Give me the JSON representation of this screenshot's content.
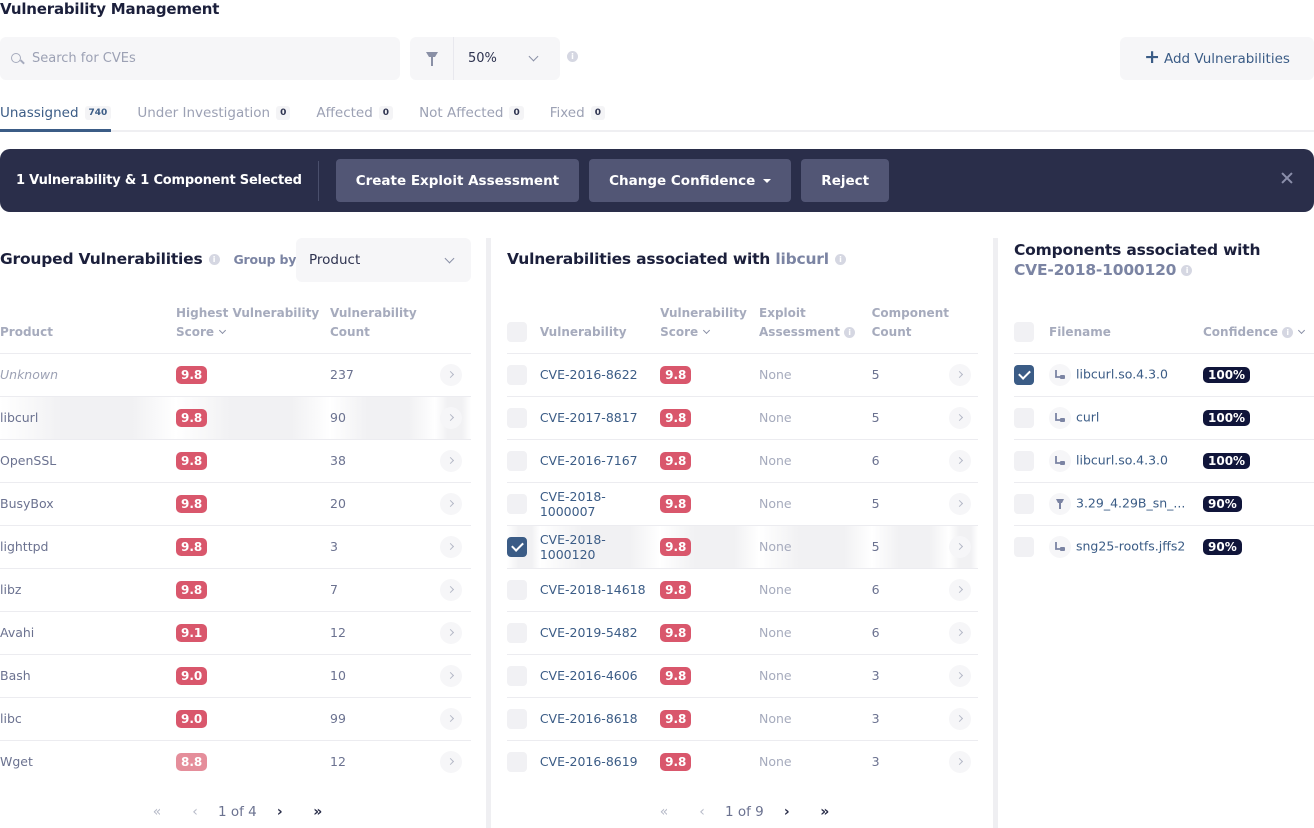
{
  "header": {
    "title": "Vulnerability Management",
    "search_placeholder": "Search for CVEs",
    "search_value": "",
    "confidence_value": "50%",
    "add_button_label": "Add Vulnerabilities",
    "add_button_icon": "plus-icon"
  },
  "tabs": [
    {
      "label": "Unassigned",
      "count": "740",
      "active": true
    },
    {
      "label": "Under Investigation",
      "count": "0",
      "active": false
    },
    {
      "label": "Affected",
      "count": "0",
      "active": false
    },
    {
      "label": "Not Affected",
      "count": "0",
      "active": false
    },
    {
      "label": "Fixed",
      "count": "0",
      "active": false
    }
  ],
  "selection_bar": {
    "text": "1 Vulnerability & 1 Component Selected",
    "buttons": {
      "create_exploit": "Create Exploit Assessment",
      "change_confidence": "Change Confidence",
      "reject": "Reject"
    },
    "colors": {
      "background": "#2a2e4a",
      "button": "#525675"
    }
  },
  "grouped": {
    "title": "Grouped Vulnerabilities",
    "group_by_label": "Group by",
    "group_by_value": "Product",
    "columns": {
      "product": "Product",
      "score": "Highest Vulnerability Score",
      "count": "Vulnerability Count"
    },
    "rows": [
      {
        "product": "Unknown",
        "score": "9.8",
        "count": "237",
        "italic": true
      },
      {
        "product": "libcurl",
        "score": "9.8",
        "count": "90",
        "highlighted": true
      },
      {
        "product": "OpenSSL",
        "score": "9.8",
        "count": "38"
      },
      {
        "product": "BusyBox",
        "score": "9.8",
        "count": "20"
      },
      {
        "product": "lighttpd",
        "score": "9.8",
        "count": "3"
      },
      {
        "product": "libz",
        "score": "9.8",
        "count": "7"
      },
      {
        "product": "Avahi",
        "score": "9.1",
        "count": "12"
      },
      {
        "product": "Bash",
        "score": "9.0",
        "count": "10"
      },
      {
        "product": "libc",
        "score": "9.0",
        "count": "99"
      },
      {
        "product": "Wget",
        "score": "8.8",
        "count": "12",
        "light": true
      }
    ],
    "pagination": {
      "text": "1 of 4"
    }
  },
  "vulns": {
    "title_prefix": "Vulnerabilities associated with",
    "title_subject": "libcurl",
    "columns": {
      "vulnerability": "Vulnerability",
      "score": "Vulnerability Score",
      "exploit": "Exploit Assessment",
      "component_count": "Component Count"
    },
    "rows": [
      {
        "cve": "CVE-2016-8622",
        "score": "9.8",
        "exploit": "None",
        "count": "5",
        "checked": false
      },
      {
        "cve": "CVE-2017-8817",
        "score": "9.8",
        "exploit": "None",
        "count": "5",
        "checked": false
      },
      {
        "cve": "CVE-2016-7167",
        "score": "9.8",
        "exploit": "None",
        "count": "6",
        "checked": false
      },
      {
        "cve": "CVE-2018-1000007",
        "score": "9.8",
        "exploit": "None",
        "count": "5",
        "checked": false
      },
      {
        "cve": "CVE-2018-1000120",
        "score": "9.8",
        "exploit": "None",
        "count": "5",
        "checked": true
      },
      {
        "cve": "CVE-2018-14618",
        "score": "9.8",
        "exploit": "None",
        "count": "6",
        "checked": false
      },
      {
        "cve": "CVE-2019-5482",
        "score": "9.8",
        "exploit": "None",
        "count": "6",
        "checked": false
      },
      {
        "cve": "CVE-2016-4606",
        "score": "9.8",
        "exploit": "None",
        "count": "3",
        "checked": false
      },
      {
        "cve": "CVE-2016-8618",
        "score": "9.8",
        "exploit": "None",
        "count": "3",
        "checked": false
      },
      {
        "cve": "CVE-2016-8619",
        "score": "9.8",
        "exploit": "None",
        "count": "3",
        "checked": false
      }
    ],
    "pagination": {
      "text": "1 of 9"
    }
  },
  "components": {
    "title_prefix": "Components associated with",
    "title_subject": "CVE-2018-1000120",
    "columns": {
      "filename": "Filename",
      "confidence": "Confidence"
    },
    "rows": [
      {
        "filename": "libcurl.so.4.3.0",
        "confidence": "100%",
        "icon": "file-tree-icon",
        "checked": true
      },
      {
        "filename": "curl",
        "confidence": "100%",
        "icon": "file-tree-icon",
        "checked": false
      },
      {
        "filename": "libcurl.so.4.3.0",
        "confidence": "100%",
        "icon": "file-tree-icon",
        "checked": false
      },
      {
        "filename": "3.29_4.29B_sn_...",
        "confidence": "90%",
        "icon": "firmware-icon",
        "checked": false
      },
      {
        "filename": "sng25-rootfs.jffs2",
        "confidence": "90%",
        "icon": "file-tree-icon",
        "checked": false
      }
    ]
  },
  "colors": {
    "accent": "#3b5c86",
    "score_critical": "#d9576c",
    "score_high": "#e58e9b",
    "confidence_badge": "#10153a"
  }
}
